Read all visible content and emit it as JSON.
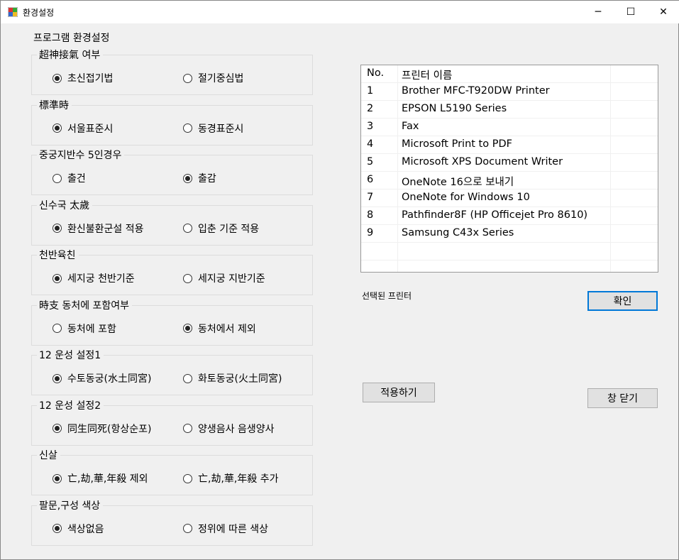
{
  "window": {
    "title": "환경설정",
    "minimize": "─",
    "maximize": "☐",
    "close": "✕"
  },
  "heading": "프로그램 환경설정",
  "groups": [
    {
      "label": "超神接氣 여부",
      "options": [
        "초신접기법",
        "절기중심법"
      ],
      "selected": 0
    },
    {
      "label": "標準時",
      "options": [
        "서울표준시",
        "동경표준시"
      ],
      "selected": 0
    },
    {
      "label": "중궁지반수 5인경우",
      "options": [
        "출건",
        "출감"
      ],
      "selected": 1
    },
    {
      "label": "신수국 太歲",
      "options": [
        "환신불환군설 적용",
        "입춘 기준 적용"
      ],
      "selected": 0
    },
    {
      "label": "천반육친",
      "options": [
        "세지궁 천반기준",
        "세지궁 지반기준"
      ],
      "selected": 0
    },
    {
      "label": "時支 동처에 포함여부",
      "options": [
        "동처에 포함",
        "동처에서 제외"
      ],
      "selected": 1
    },
    {
      "label": "12 운성 설정1",
      "options": [
        "수토동궁(水土同宮)",
        "화토동궁(火土同宮)"
      ],
      "selected": 0
    },
    {
      "label": "12 운성 설정2",
      "options": [
        "同生同死(항상순포)",
        "양생음사 음생양사"
      ],
      "selected": 0
    },
    {
      "label": "신살",
      "options": [
        "亡,劫,華,年殺 제외",
        "亡,劫,華,年殺 추가"
      ],
      "selected": 0
    },
    {
      "label": "팔문,구성 색상",
      "options": [
        "색상없음",
        "정위에 따른 색상"
      ],
      "selected": 0
    }
  ],
  "printers": {
    "columns": [
      "No.",
      "프린터 이름"
    ],
    "rows": [
      [
        "1",
        "Brother MFC-T920DW Printer"
      ],
      [
        "2",
        "EPSON L5190 Series"
      ],
      [
        "3",
        "Fax"
      ],
      [
        "4",
        "Microsoft Print to PDF"
      ],
      [
        "5",
        "Microsoft XPS Document Writer"
      ],
      [
        "6",
        "OneNote 16으로 보내기"
      ],
      [
        "7",
        "OneNote for Windows 10"
      ],
      [
        "8",
        "Pathfinder8F (HP Officejet Pro 8610)"
      ],
      [
        "9",
        "Samsung C43x Series"
      ]
    ]
  },
  "selected_printer_label": "선택된 프린터",
  "buttons": {
    "ok": "확인",
    "apply": "적용하기",
    "close": "창 닫기"
  }
}
